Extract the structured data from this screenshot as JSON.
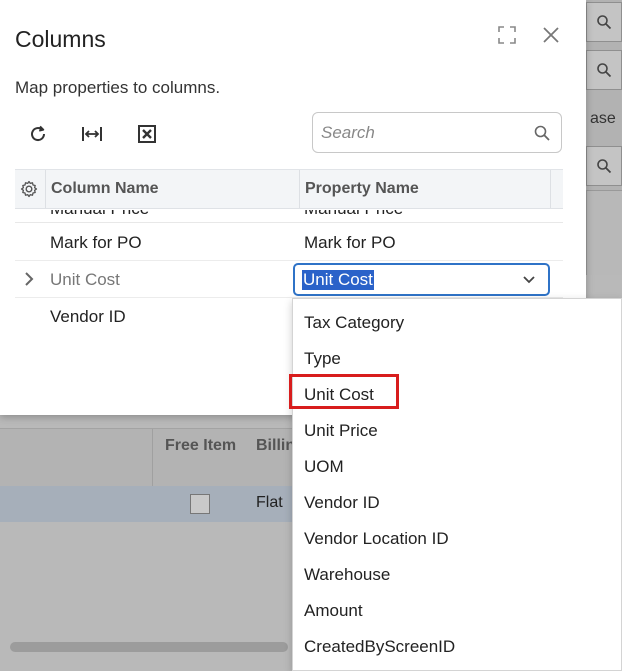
{
  "dialog": {
    "title": "Columns",
    "subtitle": "Map properties to columns.",
    "search_placeholder": "Search"
  },
  "toolbar": {
    "icons": [
      "refresh-icon",
      "fit-width-icon",
      "excel-icon"
    ]
  },
  "table": {
    "headers": {
      "column_name": "Column Name",
      "property_name": "Property Name"
    },
    "partial_row": {
      "column": "Manual Price",
      "property": "Manual Price"
    },
    "rows": [
      {
        "column": "Mark for PO",
        "property": "Mark for PO"
      },
      {
        "column": "Unit Cost",
        "property": "Unit Cost"
      },
      {
        "column": "Vendor ID",
        "property": ""
      }
    ]
  },
  "dropdown": {
    "selected": "Unit Cost",
    "highlighted": "Unit Cost",
    "options": [
      "Tax Category",
      "Type",
      "Unit Cost",
      "Unit Price",
      "UOM",
      "Vendor ID",
      "Vendor Location ID",
      "Warehouse",
      "Amount",
      "CreatedByScreenID"
    ]
  },
  "background": {
    "side_text": "ase",
    "grid_headers": [
      "Free Item",
      "Billing"
    ],
    "grid_row_value": "Flat"
  },
  "colors": {
    "selection": "#2a62c9",
    "highlight_box": "#d81d1d",
    "focus_border": "#2f73c7"
  }
}
